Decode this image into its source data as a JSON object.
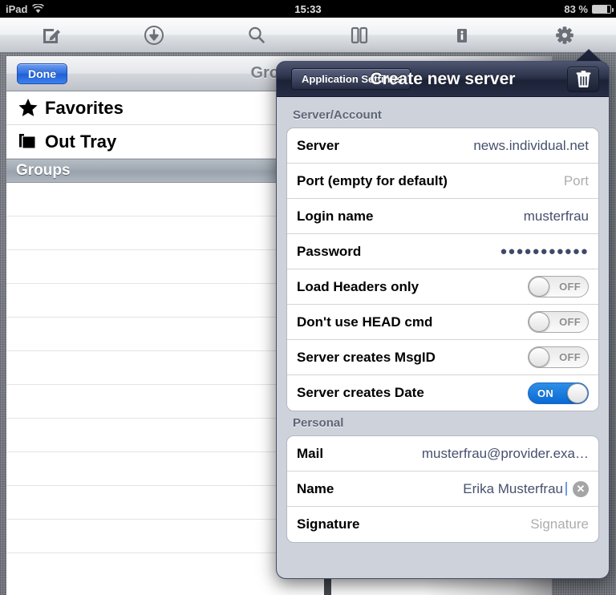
{
  "status_bar": {
    "device": "iPad",
    "wifi_icon": "wifi-icon",
    "time": "15:33",
    "battery_percent": "83 %",
    "battery_level": 83
  },
  "toolbar": {
    "items": [
      {
        "name": "compose-icon",
        "label": "Compose"
      },
      {
        "name": "download-icon",
        "label": "Download"
      },
      {
        "name": "search-icon",
        "label": "Search"
      },
      {
        "name": "split-view-icon",
        "label": "Split View"
      },
      {
        "name": "info-icon",
        "label": "Info"
      },
      {
        "name": "settings-gear-icon",
        "label": "Settings"
      }
    ]
  },
  "master_panel": {
    "nav": {
      "done_label": "Done",
      "title": "Groups"
    },
    "rows": [
      {
        "label": "Favorites",
        "icon": "star-icon"
      },
      {
        "label": "Out Tray",
        "icon": "tray-icon"
      }
    ],
    "section_header": "Groups",
    "empty_row_count": 11
  },
  "popover": {
    "header": {
      "back_label": "Application Settings",
      "title": "Create new server",
      "delete_icon": "trash-icon"
    },
    "sections": [
      {
        "title": "Server/Account",
        "rows": [
          {
            "label": "Server",
            "type": "text",
            "value": "news.individual.net",
            "placeholder": ""
          },
          {
            "label": "Port (empty for default)",
            "type": "text",
            "value": "",
            "placeholder": "Port"
          },
          {
            "label": "Login name",
            "type": "text",
            "value": "musterfrau",
            "placeholder": ""
          },
          {
            "label": "Password",
            "type": "password",
            "value": "●●●●●●●●●●●",
            "placeholder": ""
          },
          {
            "label": "Load Headers only",
            "type": "switch",
            "state": "OFF"
          },
          {
            "label": "Don't use HEAD cmd",
            "type": "switch",
            "state": "OFF"
          },
          {
            "label": "Server creates MsgID",
            "type": "switch",
            "state": "OFF"
          },
          {
            "label": "Server creates Date",
            "type": "switch",
            "state": "ON"
          }
        ]
      },
      {
        "title": "Personal",
        "rows": [
          {
            "label": "Mail",
            "type": "text",
            "value": "musterfrau@provider.exa…",
            "placeholder": ""
          },
          {
            "label": "Name",
            "type": "text-editing",
            "value": "Erika Musterfrau",
            "placeholder": "",
            "clear_icon": "clear-circle-icon"
          },
          {
            "label": "Signature",
            "type": "text",
            "value": "",
            "placeholder": "Signature"
          }
        ]
      }
    ]
  },
  "colors": {
    "accent_blue": "#2f6fe0",
    "switch_on": "#0a6ad4",
    "value_text": "#46506e",
    "popover_chrome": "#1e2439",
    "placeholder": "#adadad"
  }
}
